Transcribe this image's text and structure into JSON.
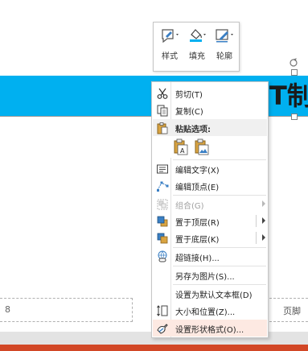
{
  "mini_toolbar": {
    "buttons": [
      {
        "label": "样式",
        "icon": "shape-style-icon"
      },
      {
        "label": "填充",
        "icon": "paint-bucket-icon"
      },
      {
        "label": "轮廓",
        "icon": "pencil-outline-icon"
      }
    ]
  },
  "slide": {
    "title_fragment": "T制",
    "footer_left_text": "8",
    "footer_right_text": "页脚",
    "title_bar_color": "#00b0f0",
    "bottom_bar_color": "#d24726"
  },
  "context_menu": {
    "items": [
      {
        "label": "剪切(T)",
        "icon": "scissors-icon"
      },
      {
        "label": "复制(C)",
        "icon": "copy-icon"
      },
      {
        "label": "粘贴选项:",
        "icon": "paste-icon"
      },
      {
        "label": "编辑文字(X)",
        "icon": "edit-text-icon"
      },
      {
        "label": "编辑顶点(E)",
        "icon": "edit-points-icon"
      },
      {
        "label": "组合(G)",
        "icon": "group-icon",
        "disabled": true,
        "submenu": true
      },
      {
        "label": "置于顶层(R)",
        "icon": "bring-to-front-icon",
        "submenu": true
      },
      {
        "label": "置于底层(K)",
        "icon": "send-to-back-icon",
        "submenu": true
      },
      {
        "label": "超链接(H)...",
        "icon": "hyperlink-icon"
      },
      {
        "label": "另存为图片(S)...",
        "icon": ""
      },
      {
        "label": "设置为默认文本框(D)",
        "icon": ""
      },
      {
        "label": "大小和位置(Z)...",
        "icon": "size-position-icon"
      },
      {
        "label": "设置形状格式(O)...",
        "icon": "format-shape-icon",
        "highlighted": true
      }
    ],
    "paste_options": [
      {
        "icon": "paste-keep-text-icon"
      },
      {
        "icon": "paste-picture-icon"
      }
    ]
  }
}
